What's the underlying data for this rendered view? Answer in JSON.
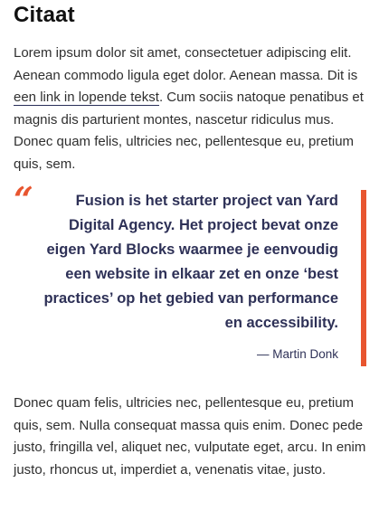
{
  "heading": "Citaat",
  "intro": {
    "text_before_link": "Lorem ipsum dolor sit amet, consectetuer adipiscing elit. Aenean commodo ligula eget dolor. Aenean massa. Dit is ",
    "link_text": "een link in lopende tekst",
    "text_after_link": ". Cum sociis natoque penatibus et magnis dis parturient montes, nascetur ridiculus mus. Donec quam felis, ultricies nec, pellentesque eu, pretium quis, sem."
  },
  "quote": {
    "mark": "“",
    "text": "Fusion is het starter project van Yard Digital Agency. Het project bevat onze eigen Yard Blocks waarmee je eenvoudig een website in elkaar zet en onze ‘best practices’ op het gebied van performance en accessibility.",
    "author": "— Martin Donk"
  },
  "outro": "Donec quam felis, ultricies nec, pellentesque eu, pretium quis, sem. Nulla consequat massa quis enim. Donec pede justo, fringilla vel, aliquet nec, vulputate eget, arcu. In enim justo, rhoncus ut, imperdiet a, venenatis vitae, justo.",
  "colors": {
    "accent": "#e8552f",
    "quote_text": "#2e3157",
    "body_text": "#2f2f2f"
  }
}
